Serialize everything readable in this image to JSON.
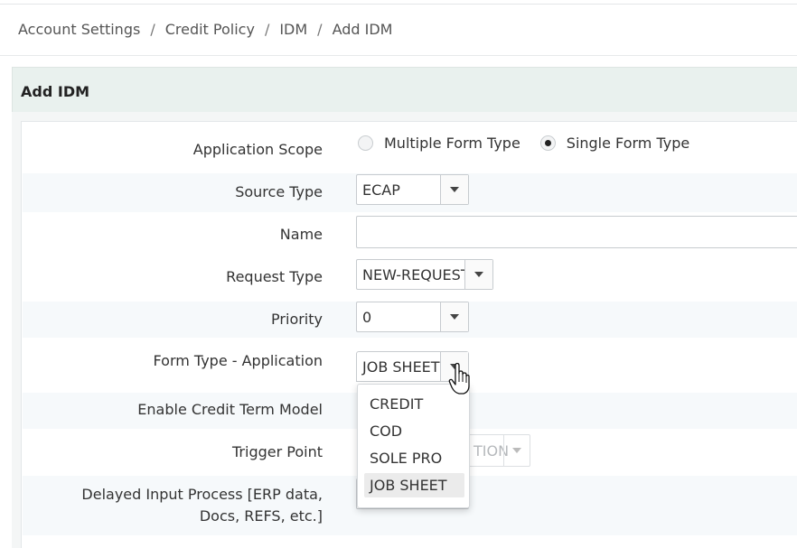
{
  "breadcrumb": {
    "items": [
      "Account Settings",
      "Credit Policy",
      "IDM",
      "Add IDM"
    ],
    "separator": "/"
  },
  "panel": {
    "title": "Add IDM"
  },
  "form": {
    "application_scope": {
      "label": "Application Scope",
      "options": [
        "Multiple Form Type",
        "Single Form Type"
      ],
      "selected": "Single Form Type"
    },
    "source_type": {
      "label": "Source Type",
      "value": "ECAP"
    },
    "name": {
      "label": "Name",
      "value": ""
    },
    "request_type": {
      "label": "Request Type",
      "value": "NEW-REQUEST"
    },
    "priority": {
      "label": "Priority",
      "value": "0"
    },
    "form_type_application": {
      "label": "Form Type - Application",
      "value": "JOB SHEET",
      "options": [
        "CREDIT",
        "COD",
        "SOLE PRO",
        "JOB SHEET"
      ],
      "highlighted": "JOB SHEET"
    },
    "enable_credit_term_model": {
      "label": "Enable Credit Term Model"
    },
    "trigger_point": {
      "label": "Trigger Point",
      "value_partial": "TION"
    },
    "delayed_input_process": {
      "label": "Delayed Input Process [ERP data, Docs, REFS, etc.]"
    }
  },
  "icons": {
    "caret": "chevron-down-icon",
    "cursor": "hand-pointer-icon"
  },
  "colors": {
    "panel_header_bg": "#e9f1ee",
    "row_alt_bg": "#f6f9fb",
    "highlight_bg": "#ebebeb"
  }
}
